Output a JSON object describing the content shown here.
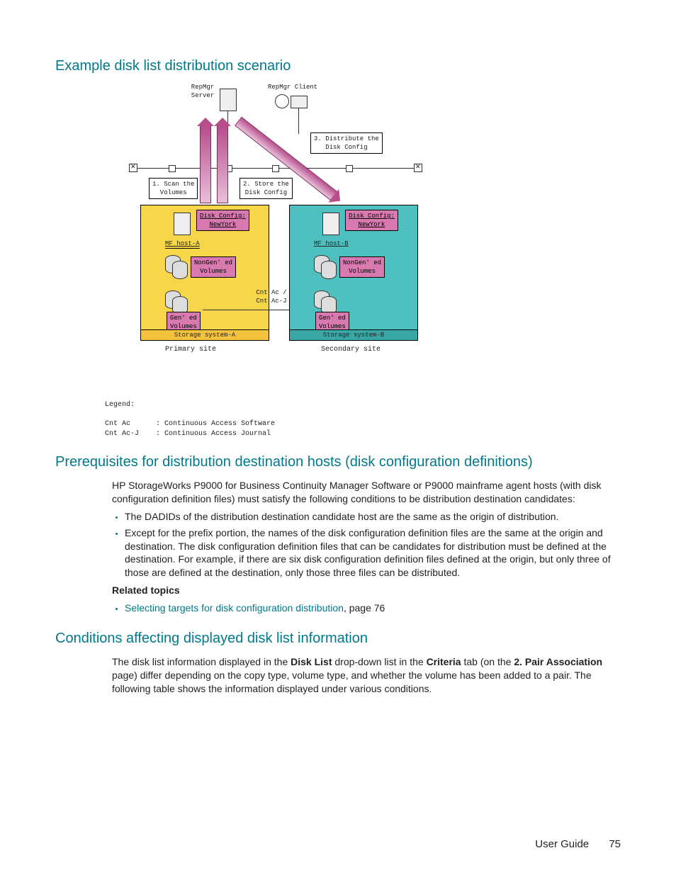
{
  "h1": "Example disk list distribution scenario",
  "diagram": {
    "repServer": "RepMgr\nServer",
    "repClient": "RepMgr Client",
    "step1": "1. Scan the\nVolumes",
    "step2": "2. Store the\nDisk Config",
    "step3": "3. Distribute the\nDisk Config",
    "diskCfg": "Disk Config:\nNewYork",
    "mfHostA": "MF host-A",
    "mfHostB": "MF host-B",
    "nonGen": "NonGen' ed\nVolumes",
    "gen": "Gen' ed\nVolumes",
    "cntac": "Cnt Ac /\nCnt Ac-J",
    "storA": "Storage system-A",
    "storB": "Storage system-B",
    "primary": "Primary site",
    "secondary": "Secondary site"
  },
  "legend": "Legend:\n\nCnt Ac      : Continuous Access Software\nCnt Ac-J    : Continuous Access Journal",
  "h2": "Prerequisites for distribution destination hosts (disk configuration definitions)",
  "prereq_intro": "HP StorageWorks P9000 for Business Continuity Manager Software or P9000 mainframe agent hosts (with disk configuration definition files) must satisfy the following conditions to be distribution destination candidates:",
  "prereq_b1": "The DADIDs of the distribution destination candidate host are the same as the origin of distribution.",
  "prereq_b2": "Except for the prefix portion, the names of the disk configuration definition files are the same at the origin and destination. The disk configuration definition files that can be candidates for distribution must be defined at the destination. For example, if there are six disk configuration definition files defined at the origin, but only three of those are defined at the destination, only those three files can be distributed.",
  "related_h": "Related topics",
  "related_link": "Selecting targets for disk configuration distribution",
  "related_tail": ", page 76",
  "h3": "Conditions affecting displayed disk list information",
  "cond_p_pre": "The disk list information displayed in the ",
  "cond_bold1": "Disk List",
  "cond_p_mid1": " drop-down list in the ",
  "cond_bold2": "Criteria",
  "cond_p_mid2": " tab (on the ",
  "cond_bold3": "2. Pair Association",
  "cond_p_tail": " page) differ depending on the copy type, volume type, and whether the volume has been added to a pair. The following table shows the information displayed under various conditions.",
  "footer_label": "User Guide",
  "footer_page": "75"
}
